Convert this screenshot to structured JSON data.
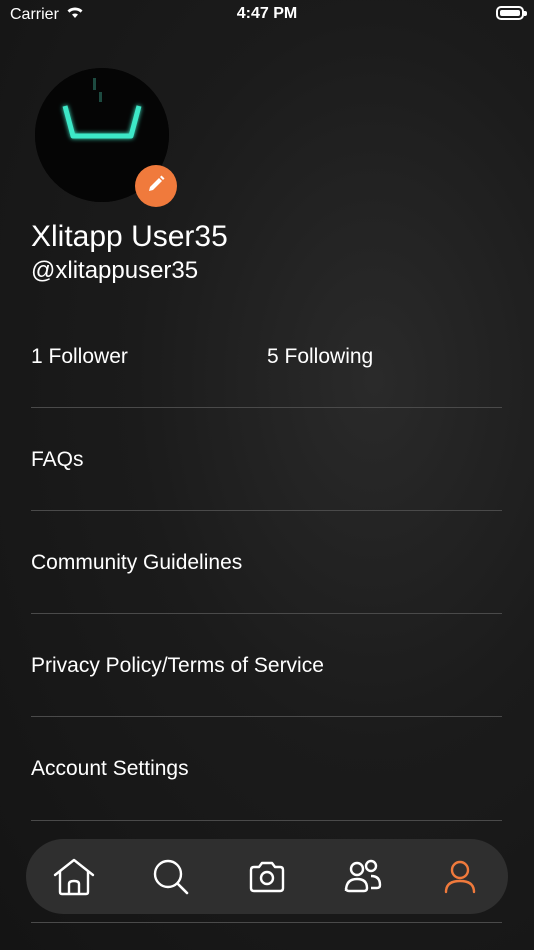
{
  "status_bar": {
    "carrier": "Carrier",
    "time": "4:47 PM",
    "icons": [
      "wifi-icon",
      "battery-icon"
    ]
  },
  "profile": {
    "display_name": "Xlitapp User35",
    "handle": "@xlitappuser35",
    "edit_icon": "pencil-icon"
  },
  "stats": {
    "followers": "1 Follower",
    "following": "5 Following"
  },
  "menu": {
    "items": [
      {
        "label": "FAQs"
      },
      {
        "label": "Community Guidelines"
      },
      {
        "label": "Privacy Policy/Terms of Service"
      },
      {
        "label": "Account Settings"
      }
    ]
  },
  "tab_bar": {
    "tabs": [
      {
        "icon": "home-icon",
        "active": false
      },
      {
        "icon": "search-icon",
        "active": false
      },
      {
        "icon": "camera-icon",
        "active": false
      },
      {
        "icon": "people-icon",
        "active": false
      },
      {
        "icon": "profile-icon",
        "active": true
      }
    ]
  },
  "colors": {
    "accent": "#f07a3c",
    "background": "#1b1b1b",
    "tab_bar": "#2f2f2f",
    "divider": "#4a4a4a",
    "text": "#ffffff"
  }
}
